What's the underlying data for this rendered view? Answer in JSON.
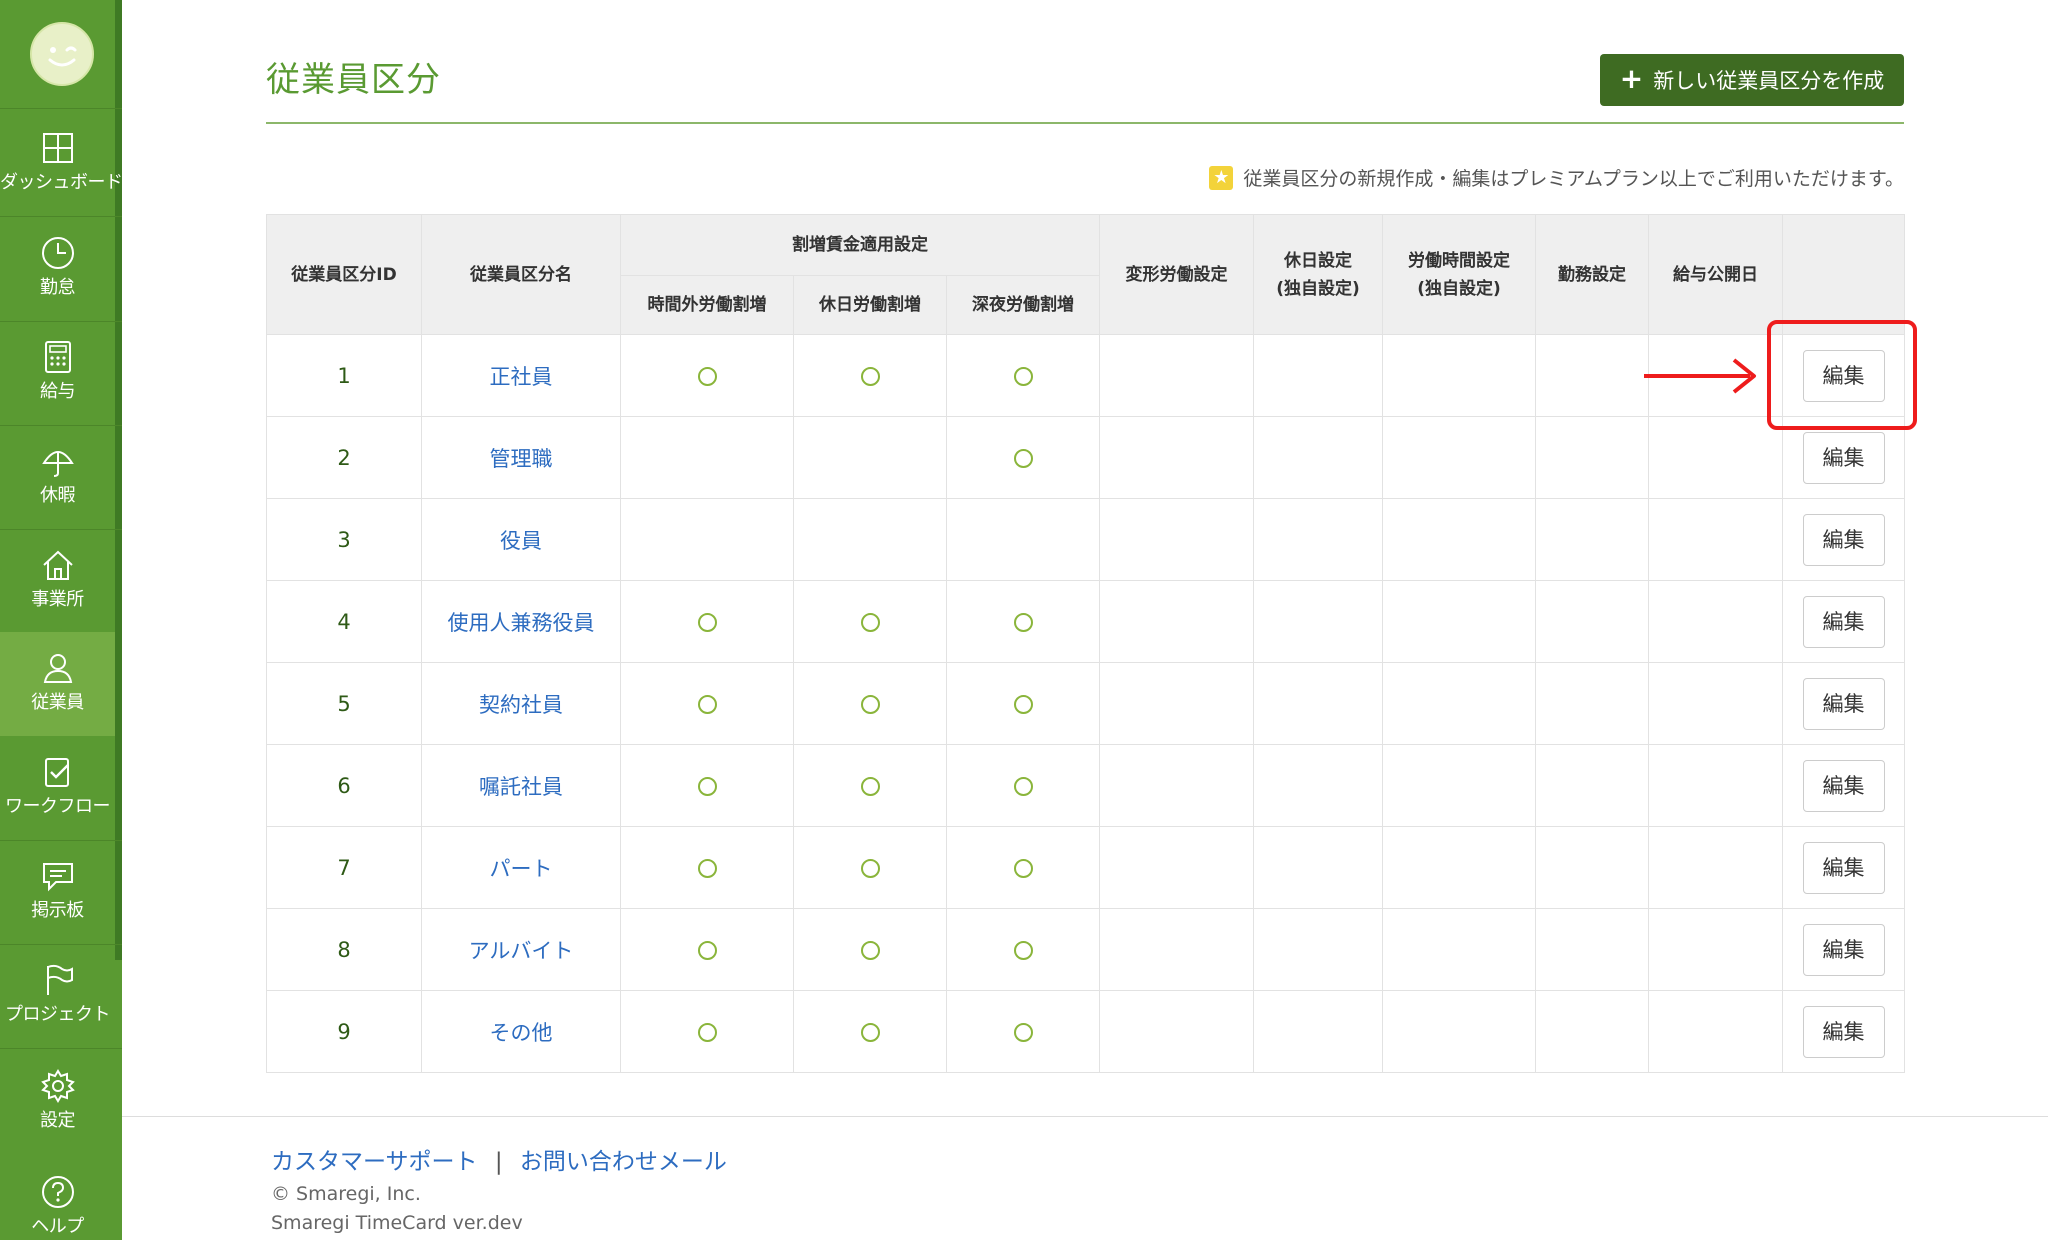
{
  "sidebar": {
    "logo_icon": "smiley-logo-icon",
    "items": [
      {
        "label": "ダッシュボード",
        "icon": "dashboard-icon",
        "active": false
      },
      {
        "label": "勤怠",
        "icon": "clock-icon",
        "active": false
      },
      {
        "label": "給与",
        "icon": "calculator-icon",
        "active": false
      },
      {
        "label": "休暇",
        "icon": "umbrella-icon",
        "active": false
      },
      {
        "label": "事業所",
        "icon": "home-icon",
        "active": false
      },
      {
        "label": "従業員",
        "icon": "person-icon",
        "active": true
      },
      {
        "label": "ワークフロー",
        "icon": "clipboard-check-icon",
        "active": false
      },
      {
        "label": "掲示板",
        "icon": "chat-icon",
        "active": false
      },
      {
        "label": "プロジェクト",
        "icon": "flag-icon",
        "active": false
      },
      {
        "label": "設定",
        "icon": "gear-icon",
        "active": false
      },
      {
        "label": "ヘルプ",
        "icon": "help-icon",
        "active": false
      }
    ],
    "colors": {
      "background": "#5a9a32",
      "active": "#74ac44"
    }
  },
  "header": {
    "title": "従業員区分",
    "create_button": "新しい従業員区分を作成",
    "notice": "従業員区分の新規作成・編集はプレミアムプラン以上でご利用いただけます。"
  },
  "table": {
    "headers": {
      "id": "従業員区分ID",
      "name": "従業員区分名",
      "premium_group": "割増賃金適用設定",
      "overtime": "時間外労働割増",
      "holiday": "休日労働割増",
      "night": "深夜労働割増",
      "variable": "変形労働設定",
      "holiday_setting_1": "休日設定",
      "holiday_setting_2": "(独自設定)",
      "worktime_setting_1": "労働時間設定",
      "worktime_setting_2": "(独自設定)",
      "duty": "勤務設定",
      "payday": "給与公開日",
      "action": ""
    },
    "mark": "○",
    "edit_label": "編集",
    "rows": [
      {
        "id": "1",
        "name": "正社員",
        "overtime": true,
        "holiday": true,
        "night": true
      },
      {
        "id": "2",
        "name": "管理職",
        "overtime": false,
        "holiday": false,
        "night": true
      },
      {
        "id": "3",
        "name": "役員",
        "overtime": false,
        "holiday": false,
        "night": false
      },
      {
        "id": "4",
        "name": "使用人兼務役員",
        "overtime": true,
        "holiday": true,
        "night": true
      },
      {
        "id": "5",
        "name": "契約社員",
        "overtime": true,
        "holiday": true,
        "night": true
      },
      {
        "id": "6",
        "name": "嘱託社員",
        "overtime": true,
        "holiday": true,
        "night": true
      },
      {
        "id": "7",
        "name": "パート",
        "overtime": true,
        "holiday": true,
        "night": true
      },
      {
        "id": "8",
        "name": "アルバイト",
        "overtime": true,
        "holiday": true,
        "night": true
      },
      {
        "id": "9",
        "name": "その他",
        "overtime": true,
        "holiday": true,
        "night": true
      }
    ]
  },
  "footer": {
    "support_link": "カスタマーサポート",
    "separator": "|",
    "mail_link": "お問い合わせメール",
    "copyright": "© Smaregi, Inc.",
    "version": "Smaregi TimeCard ver.dev"
  },
  "colors": {
    "accent_green": "#5a9a32",
    "button_dark_green": "#3e6b22",
    "link_blue": "#2d6cc0",
    "annotation_red": "#ee1c1c"
  }
}
